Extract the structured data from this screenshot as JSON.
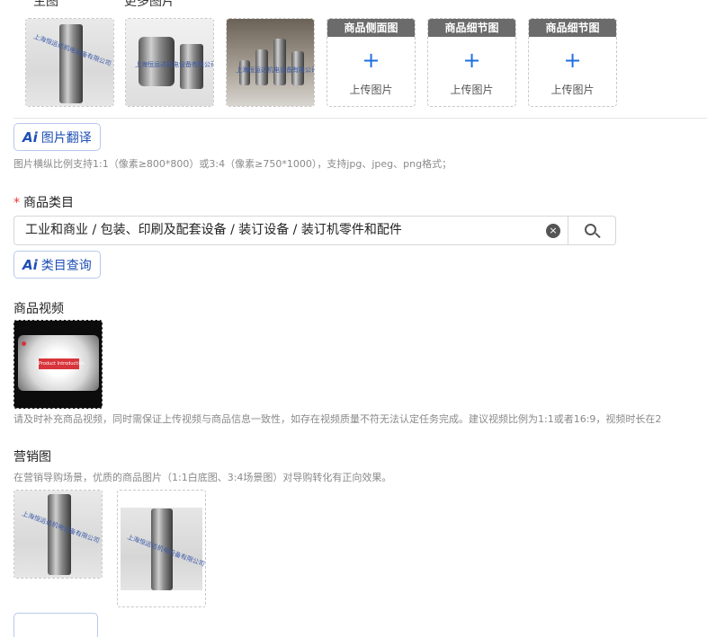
{
  "images": {
    "main_label": "主图",
    "more_label": "更多图片",
    "watermark": "上海恒运达机电设备有限公司",
    "upload_tiles": [
      {
        "header": "商品侧面图",
        "plus": "+",
        "text": "上传图片"
      },
      {
        "header": "商品细节图",
        "plus": "+",
        "text": "上传图片"
      },
      {
        "header": "商品细节图",
        "plus": "+",
        "text": "上传图片"
      }
    ],
    "translate_button": {
      "ai": "Ai",
      "label": "图片翻译"
    },
    "hint": "图片横纵比例支持1:1（像素≥800*800）或3:4（像素≥750*1000），支持jpg、jpeg、png格式；"
  },
  "category": {
    "required_mark": "*",
    "title": "商品类目",
    "value": "工业和商业 / 包装、印刷及配套设备 / 装订设备 / 装订机零件和配件",
    "clear_icon": "×",
    "query_button": {
      "ai": "Ai",
      "label": "类目查询"
    }
  },
  "video": {
    "title": "商品视频",
    "thumbnail_caption": "Product Introduction",
    "hint": "请及时补充商品视频，同时需保证上传视频与商品信息一致性，如存在视频质量不符无法认定任务完成。建议视频比例为1:1或者16:9，视频时长在2"
  },
  "marketing": {
    "title": "营销图",
    "hint": "在营销导购场景，优质的商品图片（1:1白底图、3:4场景图）对导购转化有正向效果。"
  },
  "colors": {
    "accent": "#1f6fe0",
    "ai_blue": "#1f4fb5",
    "required": "#e33333",
    "upload_header": "#6b6b6b"
  }
}
